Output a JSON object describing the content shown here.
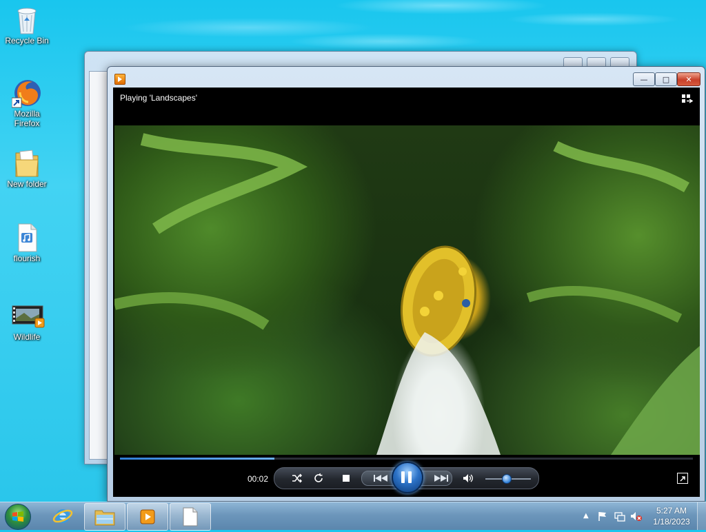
{
  "desktop": {
    "icons": [
      {
        "label": "Recycle Bin",
        "icon": "recycle-bin-icon"
      },
      {
        "label": "Mozilla Firefox",
        "icon": "firefox-icon"
      },
      {
        "label": "New folder",
        "icon": "folder-icon"
      },
      {
        "label": "flourish",
        "icon": "audio-file-icon"
      },
      {
        "label": "Wildlife",
        "icon": "video-file-icon"
      }
    ]
  },
  "player": {
    "now_playing": "Playing 'Landscapes'",
    "elapsed": "00:02",
    "progress_fraction": 0.27,
    "volume_fraction": 0.45,
    "state": "playing",
    "accent": "#2f7fd6"
  },
  "taskbar": {
    "pinned": [
      "windows-explorer-icon",
      "internet-explorer-icon"
    ],
    "running": [
      "media-player-icon",
      "blank-document-icon"
    ],
    "clock_time": "5:27 AM",
    "clock_date": "1/18/2023"
  }
}
